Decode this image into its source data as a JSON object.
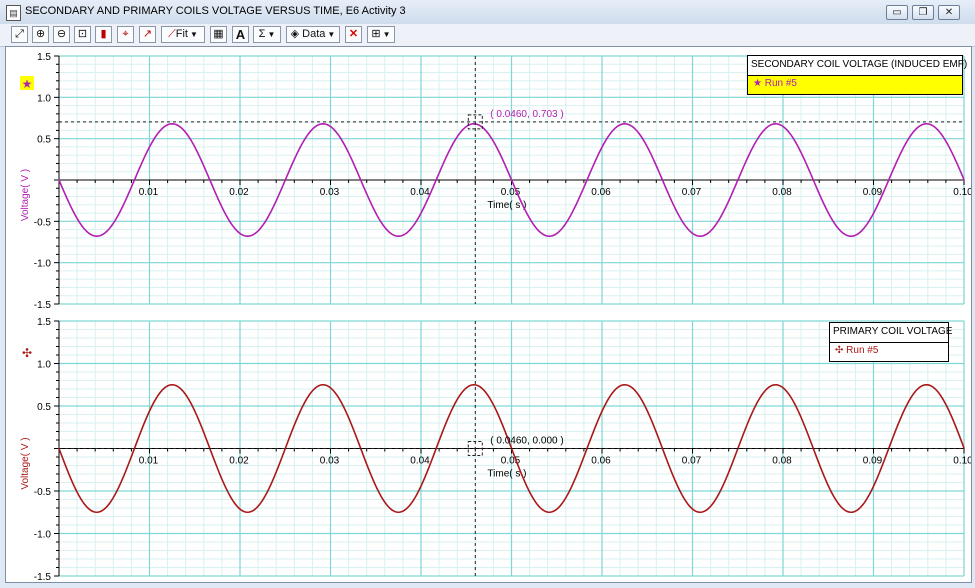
{
  "window": {
    "title": "SECONDARY AND PRIMARY COILS VOLTAGE VERSUS TIME, E6 Activity 3",
    "icon": "graph-doc-icon",
    "minimize_glyph": "▭",
    "restore_glyph": "❐",
    "close_glyph": "✕"
  },
  "toolbar": {
    "buttons": [
      {
        "name": "scale-to-fit-icon"
      },
      {
        "name": "zoom-in-icon"
      },
      {
        "name": "zoom-out-icon"
      },
      {
        "name": "zoom-select-icon"
      },
      {
        "name": "data-lock-icon"
      },
      {
        "name": "smart-tool-icon"
      },
      {
        "name": "slope-tool-icon"
      },
      {
        "name": "curve-fit-icon"
      },
      {
        "name": "calculator-icon"
      },
      {
        "name": "annotation-icon"
      },
      {
        "name": "statistics-icon"
      },
      {
        "name": "data-select-icon"
      },
      {
        "name": "delete-icon"
      },
      {
        "name": "graph-settings-icon"
      }
    ],
    "fit_label": "Fit",
    "data_label": "Data",
    "sigma_label": "Σ",
    "annotation_label": "A"
  },
  "colors": {
    "secondary": "#b21fb2",
    "primary": "#aa1818",
    "grid_major": "#7fd6d6",
    "grid_minor": "#d9f0f0",
    "legend_highlight": "#ffff00"
  },
  "plots": [
    {
      "id": "secondary",
      "ylabel": "Voltage( V )",
      "xlabel": "Time( s )",
      "legend_title": "SECONDARY COIL VOLTAGE (INDUCED EMF)",
      "legend_run": "Run #5",
      "legend_symbol": "★",
      "legend_highlight": true,
      "run_symbol_name": "star-icon",
      "cursor_label": "( 0.0460, 0.703 )"
    },
    {
      "id": "primary",
      "ylabel": "Voltage( V )",
      "xlabel": "Time( s )",
      "legend_title": "PRIMARY COIL VOLTAGE",
      "legend_run": "Run #5",
      "legend_symbol": "✣",
      "legend_highlight": false,
      "run_symbol_name": "cross-arrows-icon",
      "cursor_label": "( 0.0460, 0.000 )"
    }
  ],
  "chart_data": [
    {
      "type": "line",
      "title": "SECONDARY COIL VOLTAGE (INDUCED EMF)",
      "xlabel": "Time( s )",
      "ylabel": "Voltage( V )",
      "xlim": [
        0,
        0.1
      ],
      "ylim": [
        -1.5,
        1.5
      ],
      "x_ticks": [
        0.01,
        0.02,
        0.03,
        0.04,
        0.05,
        0.06,
        0.07,
        0.08,
        0.09,
        0.1
      ],
      "x_tick_labels": [
        "0.01",
        "0.02",
        "0.03",
        "0.04",
        "0.05",
        "0.06",
        "0.07",
        "0.08",
        "0.09",
        "0.10"
      ],
      "y_ticks": [
        1.5,
        1.0,
        0.5,
        -0.5,
        -1.0,
        -1.5
      ],
      "y_tick_labels": [
        "1.5",
        "1.0",
        "0.5",
        "-0.5",
        "-1.0",
        "-1.5"
      ],
      "grid": true,
      "legend": "top-right",
      "series": [
        {
          "name": "Run #5",
          "x": [
            0.0,
            0.00417,
            0.00833,
            0.0125,
            0.01667,
            0.02083,
            0.025,
            0.02917,
            0.03333,
            0.0375,
            0.04167,
            0.04583,
            0.05,
            0.05417,
            0.05833,
            0.0625,
            0.06667,
            0.07083,
            0.075,
            0.07917,
            0.08333,
            0.0875,
            0.09167,
            0.09583,
            0.1
          ],
          "y": [
            0.0,
            -0.68,
            0.0,
            0.68,
            0.0,
            -0.68,
            0.0,
            0.68,
            0.0,
            -0.68,
            0.0,
            0.68,
            0.0,
            -0.68,
            0.0,
            0.68,
            0.0,
            -0.68,
            0.0,
            0.68,
            0.0,
            -0.68,
            0.0,
            0.68,
            0.0
          ]
        }
      ],
      "cursor": {
        "x": 0.046,
        "y": 0.703,
        "label": "( 0.0460, 0.703 )"
      }
    },
    {
      "type": "line",
      "title": "PRIMARY COIL VOLTAGE",
      "xlabel": "Time( s )",
      "ylabel": "Voltage( V )",
      "xlim": [
        0,
        0.1
      ],
      "ylim": [
        -1.5,
        1.5
      ],
      "x_ticks": [
        0.01,
        0.02,
        0.03,
        0.04,
        0.05,
        0.06,
        0.07,
        0.08,
        0.09,
        0.1
      ],
      "x_tick_labels": [
        "0.01",
        "0.02",
        "0.03",
        "0.04",
        "0.05",
        "0.06",
        "0.07",
        "0.08",
        "0.09",
        "0.10"
      ],
      "y_ticks": [
        1.5,
        1.0,
        0.5,
        -0.5,
        -1.0,
        -1.5
      ],
      "y_tick_labels": [
        "1.5",
        "1.0",
        "0.5",
        "-0.5",
        "-1.0",
        "-1.5"
      ],
      "grid": true,
      "legend": "top-right",
      "series": [
        {
          "name": "Run #5",
          "x": [
            0.0,
            0.00417,
            0.00833,
            0.0125,
            0.01667,
            0.02083,
            0.025,
            0.02917,
            0.03333,
            0.0375,
            0.04167,
            0.04583,
            0.05,
            0.05417,
            0.05833,
            0.0625,
            0.06667,
            0.07083,
            0.075,
            0.07917,
            0.08333,
            0.0875,
            0.09167,
            0.09583,
            0.1
          ],
          "y": [
            0.0,
            -0.75,
            0.0,
            0.75,
            0.0,
            -0.75,
            0.0,
            0.75,
            0.0,
            -0.75,
            0.0,
            0.75,
            0.0,
            -0.75,
            0.0,
            0.75,
            0.0,
            -0.75,
            0.0,
            0.75,
            0.0,
            -0.75,
            0.0,
            0.75,
            0.0
          ]
        }
      ],
      "cursor": {
        "x": 0.046,
        "y": 0.0,
        "label": "( 0.0460, 0.000 )"
      }
    }
  ]
}
